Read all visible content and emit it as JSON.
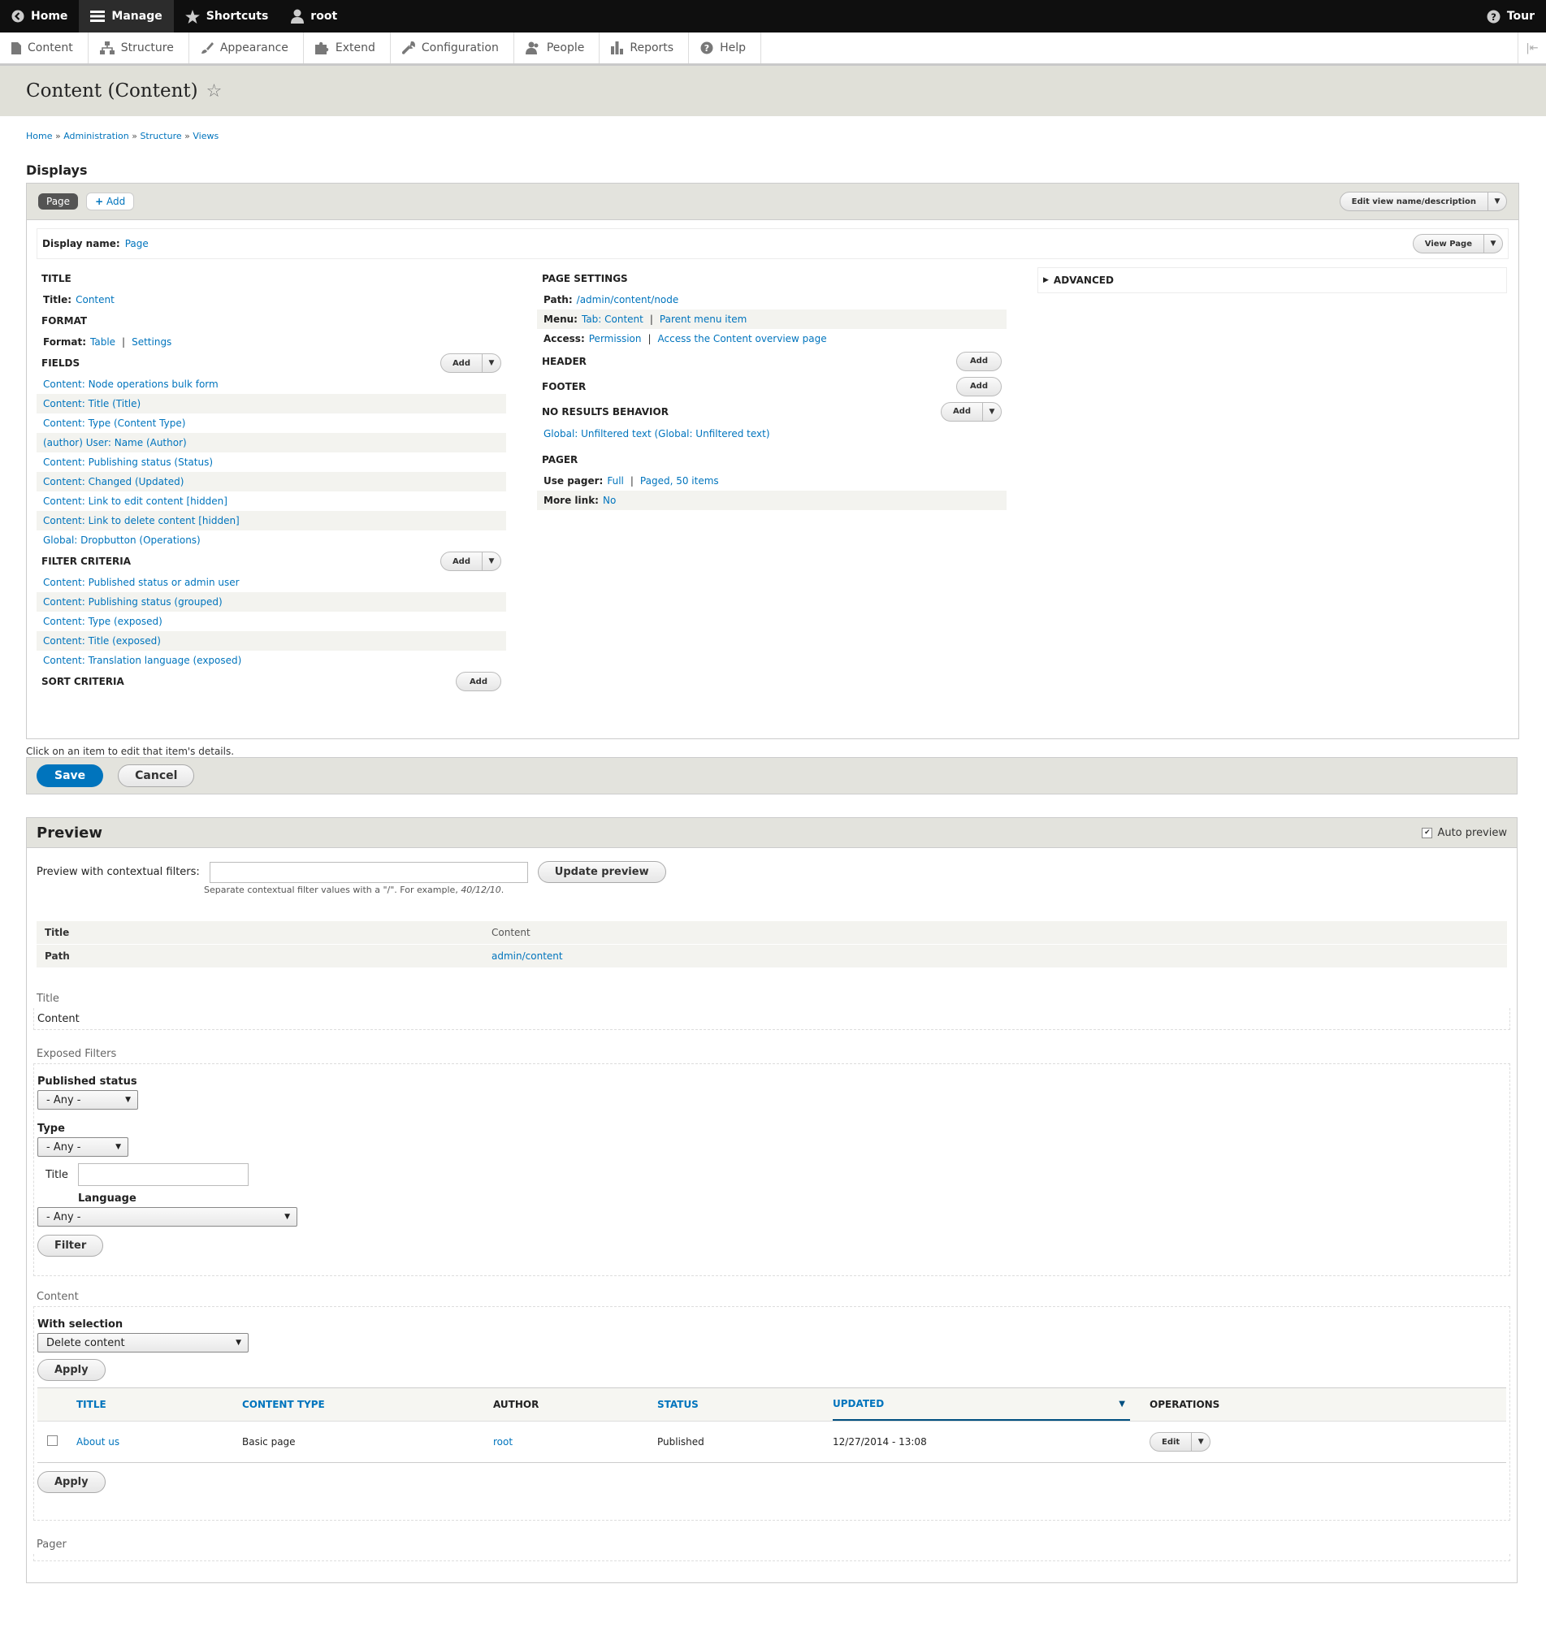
{
  "toolbar": {
    "home": "Home",
    "manage": "Manage",
    "shortcuts": "Shortcuts",
    "user": "root",
    "tour": "Tour"
  },
  "tray": {
    "items": [
      "Content",
      "Structure",
      "Appearance",
      "Extend",
      "Configuration",
      "People",
      "Reports",
      "Help"
    ]
  },
  "page": {
    "title": "Content (Content)"
  },
  "breadcrumb": [
    "Home",
    "Administration",
    "Structure",
    "Views"
  ],
  "displays": {
    "heading": "Displays",
    "tab_page": "Page",
    "tab_add": "Add",
    "edit_view": "Edit view name/description",
    "display_name_label": "Display name:",
    "display_name_value": "Page",
    "view_page": "View Page",
    "title_section": "TITLE",
    "title_label": "Title:",
    "title_value": "Content",
    "format_section": "FORMAT",
    "format_label": "Format:",
    "format_table": "Table",
    "format_settings": "Settings",
    "fields_section": "FIELDS",
    "add": "Add",
    "fields": [
      "Content: Node operations bulk form",
      "Content: Title (Title)",
      "Content: Type (Content Type)",
      "(author) User: Name (Author)",
      "Content: Publishing status (Status)",
      "Content: Changed (Updated)",
      "Content: Link to edit content [hidden]",
      "Content: Link to delete content [hidden]",
      "Global: Dropbutton (Operations)"
    ],
    "filter_section": "FILTER CRITERIA",
    "filters": [
      "Content: Published status or admin user",
      "Content: Publishing status (grouped)",
      "Content: Type (exposed)",
      "Content: Title (exposed)",
      "Content: Translation language (exposed)"
    ],
    "sort_section": "SORT CRITERIA",
    "page_settings_section": "PAGE SETTINGS",
    "path_label": "Path:",
    "path_value": "/admin/content/node",
    "menu_label": "Menu:",
    "menu_value": "Tab: Content",
    "menu_parent": "Parent menu item",
    "access_label": "Access:",
    "access_value": "Permission",
    "access_detail": "Access the Content overview page",
    "header_section": "HEADER",
    "footer_section": "FOOTER",
    "no_results_section": "NO RESULTS BEHAVIOR",
    "no_results_item": "Global: Unfiltered text (Global: Unfiltered text)",
    "pager_section": "PAGER",
    "use_pager_label": "Use pager:",
    "use_pager_full": "Full",
    "use_pager_paged": "Paged, 50 items",
    "more_link_label": "More link:",
    "more_link_value": "No",
    "advanced": "ADVANCED"
  },
  "note": "Click on an item to edit that item's details.",
  "actions": {
    "save": "Save",
    "cancel": "Cancel"
  },
  "preview": {
    "heading": "Preview",
    "auto_preview": "Auto preview",
    "ctx_label": "Preview with contextual filters:",
    "ctx_value": "",
    "update": "Update preview",
    "ctx_desc_pre": "Separate contextual filter values with a \"/\". For example, ",
    "ctx_desc_example": "40/12/10",
    "ctx_desc_post": ".",
    "info": [
      {
        "k": "Title",
        "v": "Content"
      },
      {
        "k": "Path",
        "v": "admin/content"
      }
    ],
    "title_block_label": "Title",
    "title_block_value": "Content",
    "exposed_label": "Exposed Filters",
    "published_status_label": "Published status",
    "published_status_value": "- Any -",
    "type_label": "Type",
    "type_value": "- Any -",
    "title_filter_label": "Title",
    "title_filter_value": "",
    "language_label": "Language",
    "language_value": "- Any -",
    "filter_btn": "Filter",
    "content_label": "Content",
    "with_selection_label": "With selection",
    "with_selection_value": "Delete content",
    "apply": "Apply",
    "columns": [
      "TITLE",
      "CONTENT TYPE",
      "AUTHOR",
      "STATUS",
      "UPDATED",
      "OPERATIONS"
    ],
    "rows": [
      {
        "title": "About us",
        "type": "Basic page",
        "author": "root",
        "status": "Published",
        "updated": "12/27/2014 - 13:08",
        "op": "Edit"
      }
    ],
    "pager_label": "Pager"
  }
}
